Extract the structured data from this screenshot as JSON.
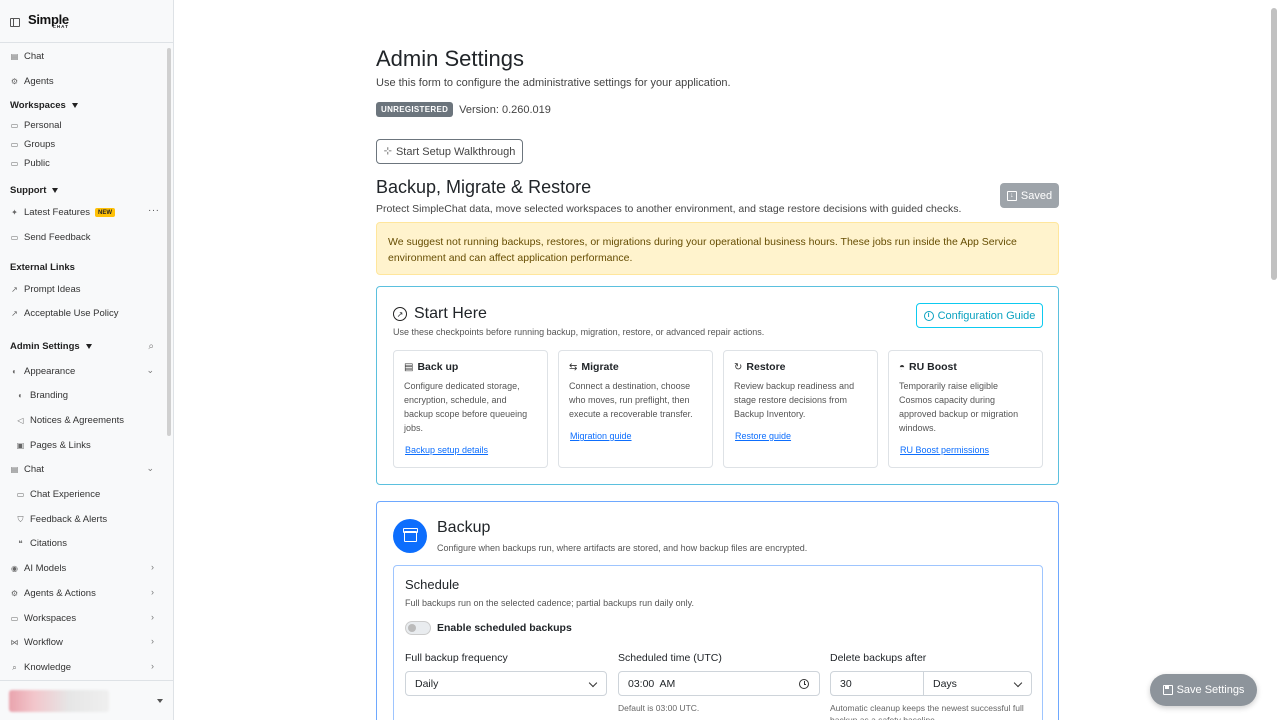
{
  "brand": {
    "name": "Simple",
    "tag": "CHAT"
  },
  "sidebar": {
    "chat": "Chat",
    "agents": "Agents",
    "workspaces_head": "Workspaces",
    "personal": "Personal",
    "groups": "Groups",
    "public": "Public",
    "support_head": "Support",
    "latest_features": "Latest Features",
    "new_badge": "NEW",
    "send_feedback": "Send Feedback",
    "external_head": "External Links",
    "prompt_ideas": "Prompt Ideas",
    "acceptable_use": "Acceptable Use Policy",
    "admin_head": "Admin Settings",
    "appearance": "Appearance",
    "branding": "Branding",
    "notices": "Notices & Agreements",
    "pages_links": "Pages & Links",
    "chat_section": "Chat",
    "chat_experience": "Chat Experience",
    "feedback_alerts": "Feedback & Alerts",
    "citations": "Citations",
    "ai_models": "AI Models",
    "agents_actions": "Agents & Actions",
    "workspaces_section": "Workspaces",
    "workflow": "Workflow",
    "knowledge": "Knowledge"
  },
  "page": {
    "title": "Admin Settings",
    "lead": "Use this form to configure the administrative settings for your application.",
    "badge": "UNREGISTERED",
    "version": "Version: 0.260.019",
    "walkthrough_btn": "Start Setup Walkthrough"
  },
  "section": {
    "title": "Backup, Migrate & Restore",
    "desc": "Protect SimpleChat data, move selected workspaces to another environment, and stage restore decisions with guided checks.",
    "saved_btn": "Saved",
    "alert": "We suggest not running backups, restores, or migrations during your operational business hours. These jobs run inside the App Service environment and can affect application performance."
  },
  "start_here": {
    "title": "Start Here",
    "desc": "Use these checkpoints before running backup, migration, restore, or advanced repair actions.",
    "guide_btn": "Configuration Guide",
    "steps": [
      {
        "title": "Back up",
        "desc": "Configure dedicated storage, encryption, schedule, and backup scope before queueing jobs.",
        "link": "Backup setup details"
      },
      {
        "title": "Migrate",
        "desc": "Connect a destination, choose who moves, run preflight, then execute a recoverable transfer.",
        "link": "Migration guide"
      },
      {
        "title": "Restore",
        "desc": "Review backup readiness and stage restore decisions from Backup Inventory.",
        "link": "Restore guide"
      },
      {
        "title": "RU Boost",
        "desc": "Temporarily raise eligible Cosmos capacity during approved backup or migration windows.",
        "link": "RU Boost permissions"
      }
    ]
  },
  "backup": {
    "title": "Backup",
    "desc": "Configure when backups run, where artifacts are stored, and how backup files are encrypted.",
    "schedule": {
      "title": "Schedule",
      "desc": "Full backups run on the selected cadence; partial backups run daily only.",
      "toggle_label": "Enable scheduled backups",
      "freq_label": "Full backup frequency",
      "freq_value": "Daily",
      "time_label": "Scheduled time (UTC)",
      "time_value": "03:00  AM",
      "time_hint": "Default is 03:00 UTC.",
      "delete_label": "Delete backups after",
      "delete_value": "30",
      "delete_unit": "Days",
      "delete_hint": "Automatic cleanup keeps the newest successful full backup as a safety baseline."
    }
  },
  "save_btn": "Save Settings"
}
